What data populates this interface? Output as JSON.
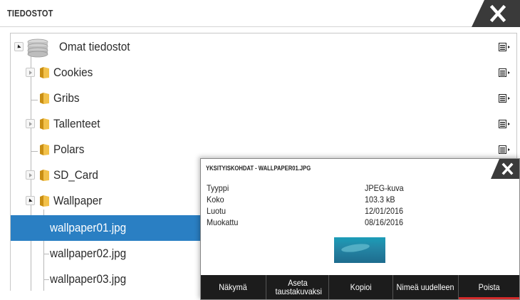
{
  "window": {
    "title": "TIEDOSTOT",
    "close_icon": "close-icon"
  },
  "tree": {
    "root": {
      "label": "Omat tiedostot",
      "icon": "drive-stack-icon",
      "expanded": true
    },
    "items": [
      {
        "label": "Cookies",
        "icon": "folder-icon",
        "expander": "collapsed"
      },
      {
        "label": "Gribs",
        "icon": "folder-icon",
        "expander": "none"
      },
      {
        "label": "Tallenteet",
        "icon": "folder-icon",
        "expander": "collapsed"
      },
      {
        "label": "Polars",
        "icon": "folder-icon",
        "expander": "none"
      },
      {
        "label": "SD_Card",
        "icon": "folder-icon",
        "expander": "collapsed"
      },
      {
        "label": "Wallpaper",
        "icon": "folder-icon",
        "expander": "expanded"
      }
    ],
    "files": [
      {
        "label": "wallpaper01.jpg",
        "selected": true
      },
      {
        "label": "wallpaper02.jpg",
        "selected": false
      },
      {
        "label": "wallpaper03.jpg",
        "selected": false
      }
    ]
  },
  "dialog": {
    "title": "YKSITYISKOHDAT - WALLPAPER01.JPG",
    "fields": [
      {
        "key": "Tyyppi",
        "value": "JPEG-kuva"
      },
      {
        "key": "Koko",
        "value": "103.3 kB"
      },
      {
        "key": "Luotu",
        "value": "12/01/2016"
      },
      {
        "key": "Muokattu",
        "value": "08/16/2016"
      }
    ],
    "thumbnail_icon": "image-thumbnail",
    "buttons": [
      {
        "label": "Näkymä"
      },
      {
        "label": "Aseta taustakuvaksi"
      },
      {
        "label": "Kopioi"
      },
      {
        "label": "Nimeä uudelleen"
      },
      {
        "label": "Poista"
      }
    ]
  },
  "colors": {
    "selection": "#2a7fc3",
    "button_bar": "#1c1c1c",
    "active_underline": "#d32a2a",
    "folder": "#e8b63a"
  }
}
